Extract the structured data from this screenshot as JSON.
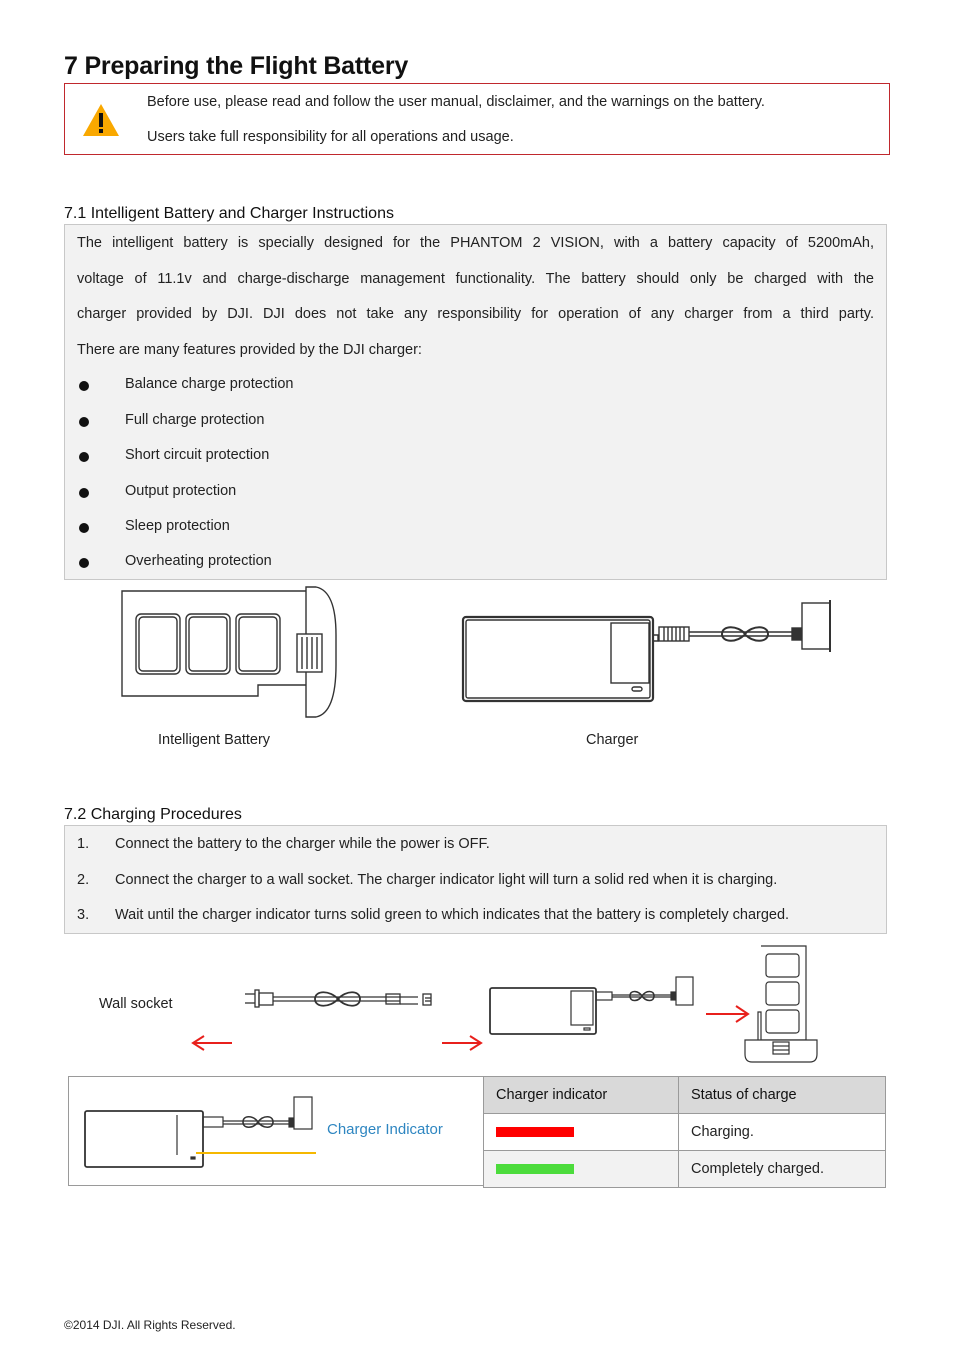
{
  "page_title": "7 Preparing the Flight Battery",
  "warning": {
    "icon": "warning-triangle-icon",
    "lines": [
      "Before use, please read and follow the user manual, disclaimer, and the warnings on the battery.",
      "Users take full responsibility for all operations and usage."
    ]
  },
  "section_7_1": {
    "heading": "7.1 Intelligent Battery and Charger Instructions",
    "paragraph_lines": [
      "The intelligent battery is specially designed for the PHANTOM 2 VISION, with a battery capacity of 5200mAh,",
      "voltage of 11.1v and charge-discharge management functionality. The battery should only be charged with the",
      "charger provided by DJI. DJI does not take any responsibility for operation of any charger from a third party.",
      "There are many features provided by the DJI charger:"
    ],
    "features": [
      "Balance charge protection",
      "Full charge protection",
      "Short circuit protection",
      "Output protection",
      "Sleep protection",
      "Overheating protection"
    ],
    "figures": {
      "battery_caption": "Intelligent Battery",
      "charger_caption": "Charger"
    }
  },
  "section_7_2": {
    "heading": "7.2 Charging Procedures",
    "steps": [
      {
        "num": "1.",
        "text": "Connect the battery to the charger while the power is OFF."
      },
      {
        "num": "2.",
        "text": "Connect the charger to a wall socket. The charger indicator light will turn a solid red when it is charging."
      },
      {
        "num": "3.",
        "text": "Wait until the charger indicator turns solid green to which indicates that the battery is completely charged."
      }
    ],
    "diagram": {
      "wall_socket_label": "Wall socket",
      "arrow_color": "#e8201c"
    },
    "indicator": {
      "callout_label": "Charger Indicator",
      "callout_color": "#2e86c1",
      "leader_color": "#f5b800",
      "table": {
        "headers": [
          "Charger indicator",
          "Status of charge"
        ],
        "rows": [
          {
            "color": "#ff0000",
            "status": "Charging."
          },
          {
            "color": "#4cdc3c",
            "status": "Completely charged."
          }
        ]
      }
    }
  },
  "footer": "©2014 DJI. All Rights Reserved."
}
